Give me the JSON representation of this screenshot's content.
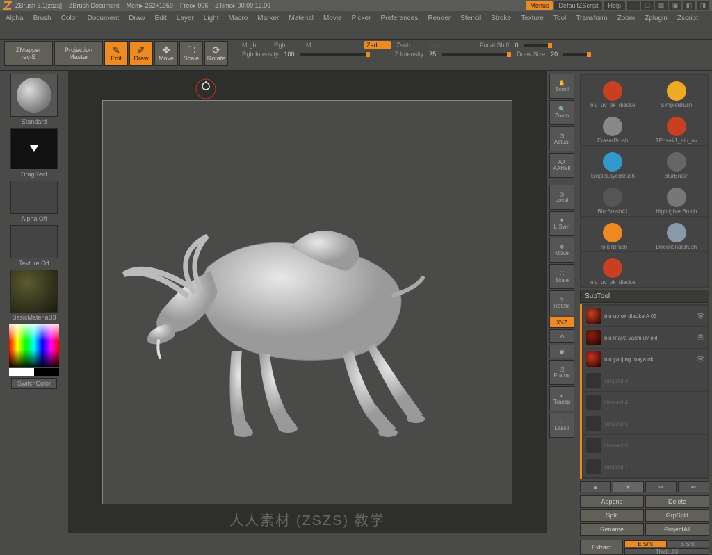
{
  "title": {
    "app": "ZBrush 3.1[zszs]",
    "doc": "ZBrush Document",
    "mem": "Mem▸ 262+1959",
    "free": "Free▸ 996",
    "ztime": "ZTime▸ 00:00:12.09",
    "menus": "Menus",
    "script": "DefaultZScript",
    "help": "Help"
  },
  "menu": [
    "Alpha",
    "Brush",
    "Color",
    "Document",
    "Draw",
    "Edit",
    "Layer",
    "Light",
    "Macro",
    "Marker",
    "Material",
    "Movie",
    "Picker",
    "Preferences",
    "Render",
    "Stencil",
    "Stroke",
    "Texture",
    "Tool",
    "Transform",
    "Zoom",
    "Zplugin",
    "Zscript"
  ],
  "toolbar": {
    "zmapper": "ZMapper\nrev-E",
    "projection": "Projection\nMaster",
    "edit": "Edit",
    "draw": "Draw",
    "move": "Move",
    "scale": "Scale",
    "rotate": "Rotate",
    "mrgb": "Mrgb",
    "rgb": "Rgb",
    "m": "M",
    "rgb_intensity_lbl": "Rgb Intensity",
    "rgb_intensity_val": "100",
    "zadd": "Zadd",
    "zsub": "Zsub",
    "zcut": "Zcut",
    "z_intensity_lbl": "Z Intensity",
    "z_intensity_val": "25",
    "focal_lbl": "Focal Shift",
    "focal_val": "0",
    "drawsize_lbl": "Draw Size",
    "drawsize_val": "20"
  },
  "left": {
    "brush": "Standard",
    "stroke": "DragRect",
    "alpha": "Alpha Off",
    "texture": "Texture Off",
    "material": "BasicMateriaB3",
    "switch": "SwitchColor"
  },
  "right_strip": [
    "Scroll",
    "Zoom",
    "Actual",
    "AAHalf",
    "",
    "Local",
    "L.Sym",
    "Move",
    "Scale",
    "Rotate",
    "XYZ",
    "",
    "",
    "Frame",
    "Transp",
    "Lasso"
  ],
  "brushes": [
    {
      "name": "niu_uv_ok_diaoke",
      "color": "#c84020"
    },
    {
      "name": "SimpleBrush",
      "color": "#eeaa22"
    },
    {
      "name": "EraserBrush",
      "color": "#888888"
    },
    {
      "name": "TPose#1_niu_uv",
      "color": "#c84020"
    },
    {
      "name": "SingleLayerBrush",
      "color": "#3399cc"
    },
    {
      "name": "BlurBrush",
      "color": "#666666"
    },
    {
      "name": "BlurBrush#1",
      "color": "#555555"
    },
    {
      "name": "HighlighterBrush",
      "color": "#777777"
    },
    {
      "name": "RollerBrush",
      "color": "#ee8822"
    },
    {
      "name": "DirectionalBrush",
      "color": "#8899aa"
    },
    {
      "name": "niu_uv_ok_diaoke",
      "color": "#c84020"
    },
    {
      "name": "",
      "color": "transparent"
    }
  ],
  "subtool": {
    "title": "SubTool",
    "items": [
      {
        "name": "niu uv ok diaoke A 03",
        "icon": "#c84020",
        "active": true
      },
      {
        "name": "niu maya yachi uv okl",
        "icon": "#882010",
        "active": true
      },
      {
        "name": "niu yanjing maya ok",
        "icon": "#cc3322",
        "active": true
      },
      {
        "name": "Unused 3",
        "icon": "",
        "active": false
      },
      {
        "name": "Unused 4",
        "icon": "",
        "active": false
      },
      {
        "name": "Unused 5",
        "icon": "",
        "active": false
      },
      {
        "name": "Unused 6",
        "icon": "",
        "active": false
      },
      {
        "name": "Unused 7",
        "icon": "",
        "active": false
      }
    ],
    "buttons": {
      "append": "Append",
      "delete": "Delete",
      "split": "Split",
      "grpsplit": "GrpSplit",
      "rename": "Rename",
      "projectall": "ProjectAll"
    },
    "extract": "Extract",
    "esmt": "E Smt",
    "ssmt": "S Smt",
    "thick": "Thick .03"
  },
  "watermark": "人人素材 (ZSZS) 教学"
}
